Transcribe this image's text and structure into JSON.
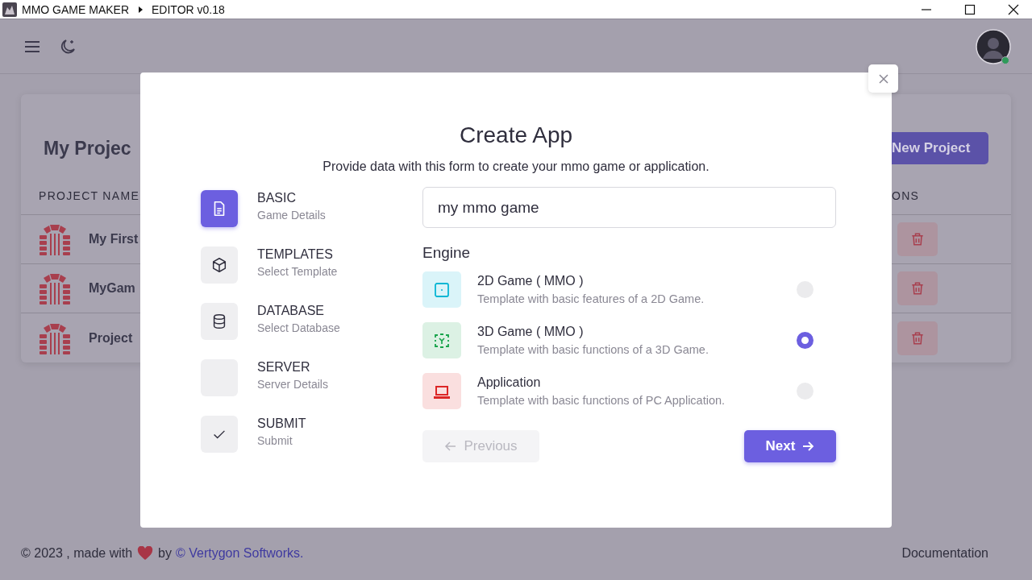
{
  "titlebar": {
    "app": "MMO GAME MAKER",
    "section": "EDITOR v0.18"
  },
  "projects": {
    "title": "My Projec",
    "new_button": "New Project",
    "columns": [
      "PROJECT NAME",
      "ONS"
    ],
    "rows": [
      {
        "name": "My First"
      },
      {
        "name": "MyGam"
      },
      {
        "name": "Project"
      }
    ]
  },
  "modal": {
    "title": "Create App",
    "subtitle": "Provide data with this form to create your mmo game or application.",
    "steps": [
      {
        "title": "BASIC",
        "subtitle": "Game Details",
        "selected": true
      },
      {
        "title": "TEMPLATES",
        "subtitle": "Select Template",
        "selected": false
      },
      {
        "title": "DATABASE",
        "subtitle": "Select Database",
        "selected": false
      },
      {
        "title": "SERVER",
        "subtitle": "Server Details",
        "selected": false
      },
      {
        "title": "SUBMIT",
        "subtitle": "Submit",
        "selected": false
      }
    ],
    "name_field": {
      "value": "my mmo game"
    },
    "engine_label": "Engine",
    "engines": [
      {
        "title": "2D Game ( MMO )",
        "description": "Template with basic features of a 2D Game.",
        "selected": false,
        "color": "#06b6d4"
      },
      {
        "title": "3D Game ( MMO )",
        "description": "Template with basic functions of a 3D Game.",
        "selected": true,
        "color": "#16a34a"
      },
      {
        "title": "Application",
        "description": "Template with basic functions of PC Application.",
        "selected": false,
        "color": "#dc2626"
      }
    ],
    "previous": {
      "label": "Previous",
      "disabled": true
    },
    "next": {
      "label": "Next"
    }
  },
  "footer": {
    "prefix": "© 2023 , made with",
    "by": "by",
    "link": "© Vertygon Softworks.",
    "documentation": "Documentation"
  }
}
